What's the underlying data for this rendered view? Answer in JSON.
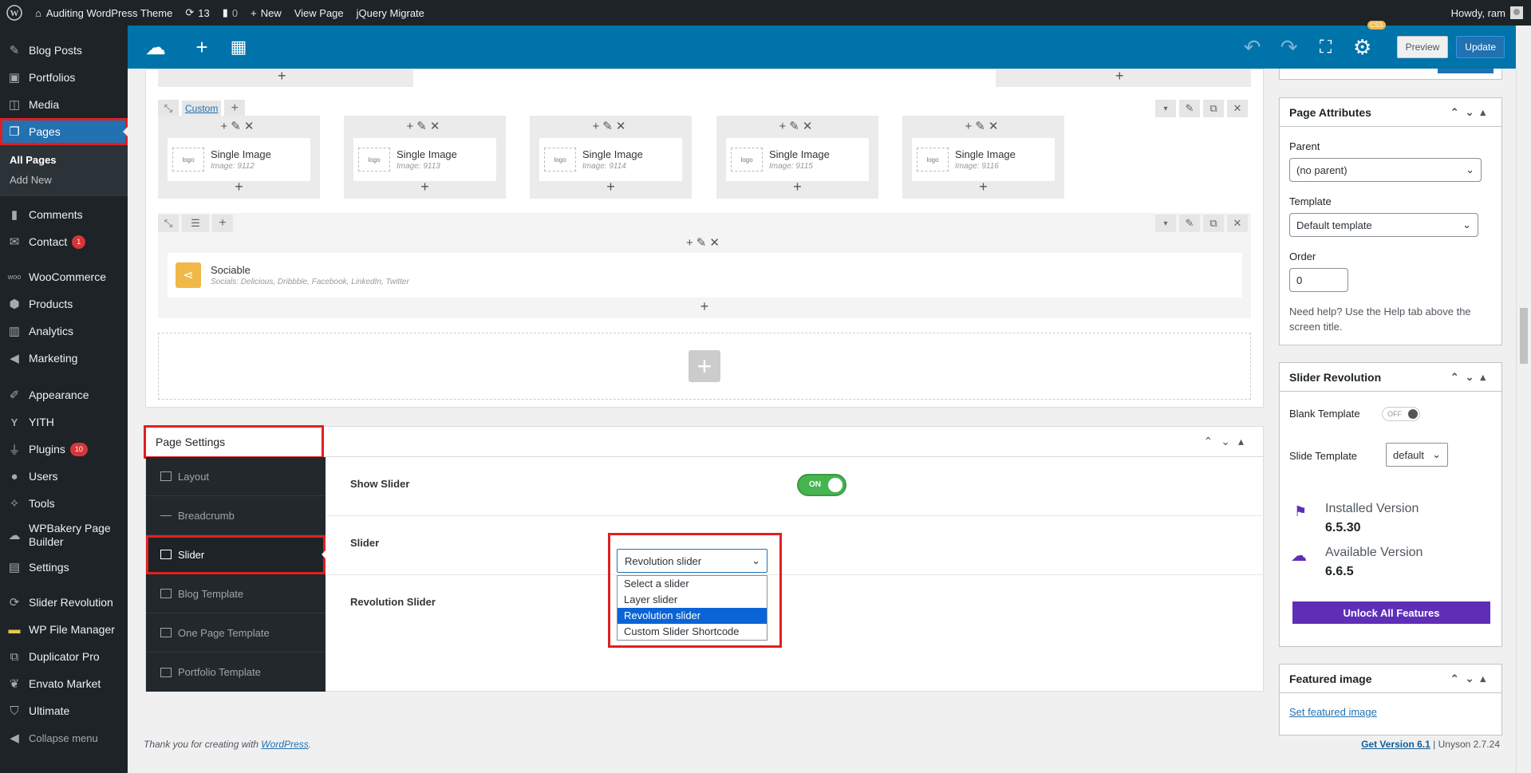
{
  "adminbar": {
    "site_name": "Auditing WordPress Theme",
    "updates_count": "13",
    "comments_count": "0",
    "new_label": "New",
    "view_page": "View Page",
    "jquery_migrate": "jQuery Migrate",
    "howdy": "Howdy, ram"
  },
  "sidebar": {
    "items": [
      {
        "label": "Blog Posts",
        "icon": "pin-icon"
      },
      {
        "label": "Portfolios",
        "icon": "portfolio-icon"
      },
      {
        "label": "Media",
        "icon": "media-icon"
      },
      {
        "label": "Pages",
        "icon": "pages-icon"
      }
    ],
    "submenu": [
      "All Pages",
      "Add New"
    ],
    "items2": [
      {
        "label": "Comments"
      },
      {
        "label": "Contact",
        "badge": "1"
      },
      {
        "label": "WooCommerce"
      },
      {
        "label": "Products"
      },
      {
        "label": "Analytics"
      },
      {
        "label": "Marketing"
      },
      {
        "label": "Appearance"
      },
      {
        "label": "YITH"
      },
      {
        "label": "Plugins",
        "badge": "10"
      },
      {
        "label": "Users"
      },
      {
        "label": "Tools"
      },
      {
        "label": "WPBakery Page Builder"
      },
      {
        "label": "Settings"
      },
      {
        "label": "Slider Revolution"
      },
      {
        "label": "WP File Manager"
      },
      {
        "label": "Duplicator Pro"
      },
      {
        "label": "Envato Market"
      },
      {
        "label": "Ultimate"
      },
      {
        "label": "Collapse menu"
      }
    ]
  },
  "toolbar": {
    "css_badge": "CSS",
    "preview": "Preview",
    "update": "Update"
  },
  "builder": {
    "row_custom_link": "Custom",
    "images": [
      {
        "title": "Single Image",
        "sub": "Image: 9112"
      },
      {
        "title": "Single Image",
        "sub": "Image: 9113"
      },
      {
        "title": "Single Image",
        "sub": "Image: 9114"
      },
      {
        "title": "Single Image",
        "sub": "Image: 9115"
      },
      {
        "title": "Single Image",
        "sub": "Image: 9116"
      }
    ],
    "sociable": {
      "title": "Sociable",
      "sub": "Socials: Delicious, Dribbble, Facebook, LinkedIn, Twitter"
    }
  },
  "page_settings": {
    "title": "Page Settings",
    "nav": [
      "Layout",
      "Breadcrumb",
      "Slider",
      "Blog Template",
      "One Page Template",
      "Portfolio Template"
    ],
    "show_slider_label": "Show Slider",
    "toggle_text": "ON",
    "slider_label": "Slider",
    "revolution_label": "Revolution Slider",
    "slider_selected": "Revolution slider",
    "slider_options": [
      "Select a slider",
      "Layer slider",
      "Revolution slider",
      "Custom Slider Shortcode"
    ]
  },
  "page_attributes": {
    "title": "Page Attributes",
    "parent_label": "Parent",
    "parent_value": "(no parent)",
    "template_label": "Template",
    "template_value": "Default template",
    "order_label": "Order",
    "order_value": "0",
    "help": "Need help? Use the Help tab above the screen title."
  },
  "slider_revolution": {
    "title": "Slider Revolution",
    "blank_template": "Blank Template",
    "off": "OFF",
    "slide_template": "Slide Template",
    "slide_template_value": "default",
    "installed_label": "Installed Version",
    "installed_value": "6.5.30",
    "available_label": "Available Version",
    "available_value": "6.6.5",
    "unlock": "Unlock All Features"
  },
  "featured_image": {
    "title": "Featured image",
    "link": "Set featured image"
  },
  "footer": {
    "thanks": "Thank you for creating with",
    "wp_link": "WordPress",
    "get_version": "Get Version 6.1",
    "unyson": "| Unyson 2.7.24"
  },
  "colors": {
    "accent": "#2271b1",
    "toolbar": "#0073aa",
    "highlight_box": "#e02020",
    "toggle_on": "#46b450",
    "unlock": "#5f2eb7"
  }
}
